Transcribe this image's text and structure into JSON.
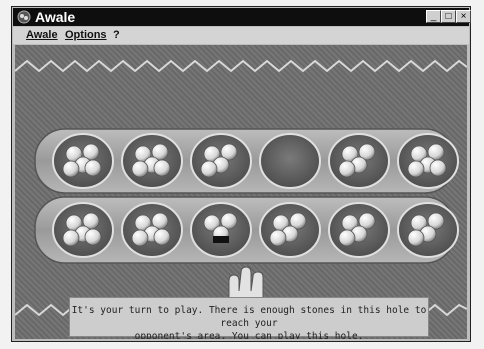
{
  "window": {
    "title": "Awale"
  },
  "menu": {
    "awale": "Awale",
    "options": "Options",
    "help": "?"
  },
  "board": {
    "top_row_stones": [
      5,
      5,
      4,
      0,
      4,
      5
    ],
    "bottom_row_stones": [
      5,
      5,
      3,
      4,
      4,
      4
    ],
    "highlighted_pit": "bottom-3"
  },
  "status": {
    "line1": "It's your turn to play. There is enough stones in this hole to reach your",
    "line2": "opponent's area. You can play this hole."
  },
  "colors": {
    "titlebar": "#0e0e0e",
    "wood": "#a4a4a4",
    "stone": "#e8e8e8"
  },
  "icons": [
    "app-icon",
    "minimize-icon",
    "maximize-icon",
    "close-icon",
    "hand-cursor-icon"
  ]
}
